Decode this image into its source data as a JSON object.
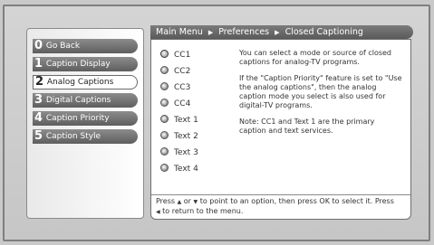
{
  "breadcrumb": {
    "items": [
      "Main Menu",
      "Preferences",
      "Closed Captioning"
    ],
    "separator": "▶"
  },
  "menu": {
    "items": [
      {
        "num": "0",
        "label": "Go Back",
        "selected": false
      },
      {
        "num": "1",
        "label": "Caption Display",
        "selected": false
      },
      {
        "num": "2",
        "label": "Analog Captions",
        "selected": true
      },
      {
        "num": "3",
        "label": "Digital Captions",
        "selected": false
      },
      {
        "num": "4",
        "label": "Caption Priority",
        "selected": false
      },
      {
        "num": "5",
        "label": "Caption Style",
        "selected": false
      }
    ]
  },
  "options": {
    "items": [
      "CC1",
      "CC2",
      "CC3",
      "CC4",
      "Text 1",
      "Text 2",
      "Text 3",
      "Text 4"
    ],
    "selected_index": 0
  },
  "help": {
    "p1": "You can select a mode or source of closed captions for analog-TV programs.",
    "p2": "If the \"Caption Priority\" feature is set to \"Use the analog captions\", then the analog caption mode you select is also used for digital-TV programs.",
    "p3": "Note: CC1 and Text 1 are the primary caption and text services."
  },
  "footer": {
    "part1": "Press",
    "up_glyph": "▲",
    "part2": "or",
    "down_glyph": "▼",
    "part3": "to point to an option, then press OK to select it. Press",
    "left_glyph": "◀",
    "part4": "to return to the menu."
  },
  "colors": {
    "background": "#c9c9c9",
    "menu_button": "#6e6e6e",
    "selected_button": "#ffffff",
    "panel": "#ffffff"
  }
}
